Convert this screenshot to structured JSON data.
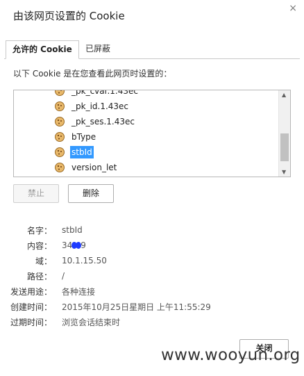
{
  "dialog": {
    "title": "由该网页设置的 Cookie",
    "close_glyph": "×"
  },
  "tabs": [
    {
      "label": "允许的 Cookie",
      "active": true
    },
    {
      "label": "已屏蔽",
      "active": false
    }
  ],
  "description": "以下 Cookie 是在您查看此网页时设置的：",
  "cookie_list": {
    "items": [
      {
        "label": "_pk_cvar.1.43ec",
        "selected": false
      },
      {
        "label": "_pk_id.1.43ec",
        "selected": false
      },
      {
        "label": "_pk_ses.1.43ec",
        "selected": false
      },
      {
        "label": "bType",
        "selected": false
      },
      {
        "label": "stbId",
        "selected": true
      },
      {
        "label": "version_let",
        "selected": false
      }
    ],
    "item_icon": "cookie-icon"
  },
  "actions": {
    "block_label": "禁止",
    "remove_label": "删除"
  },
  "details": {
    "name_label": "名字：",
    "name_value": "stbId",
    "content_label": "内容：",
    "content_prefix": "34",
    "content_suffix": "9",
    "domain_label": "域：",
    "domain_value": "10.1.15.50",
    "path_label": "路径：",
    "path_value": "/",
    "send_for_label": "发送用途：",
    "send_for_value": "各种连接",
    "created_label": "创建时间：",
    "created_value": "2015年10月25日星期日 上午11:55:29",
    "expires_label": "过期时间：",
    "expires_value": "浏览会话结束时"
  },
  "footer": {
    "close_label": "关闭"
  },
  "watermark": "www.wooyun.org",
  "colors": {
    "selection": "#3399ff",
    "redaction_blob": "#1f3cff"
  }
}
